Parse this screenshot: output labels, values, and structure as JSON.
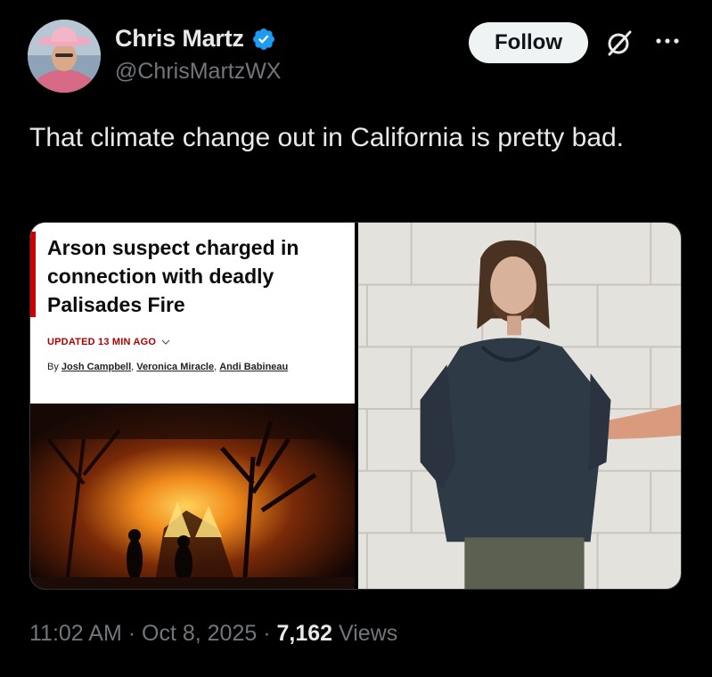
{
  "author": {
    "display_name": "Chris Martz",
    "handle": "@ChrisMartzWX",
    "verified": true
  },
  "actions": {
    "follow_label": "Follow",
    "grok_icon": "grok-icon",
    "more_icon": "more-icon"
  },
  "tweet": {
    "text": "That climate change out in California is pretty bad."
  },
  "media": {
    "article": {
      "headline": "Arson suspect charged in connection with deadly Palisades Fire",
      "updated": "UPDATED 13 MIN AGO",
      "by_prefix": "By",
      "authors": [
        "Josh Campbell",
        "Veronica Miracle",
        "Andi Babineau"
      ]
    }
  },
  "meta": {
    "time": "11:02 AM",
    "sep1": "·",
    "date": "Oct 8, 2025",
    "sep2": "·",
    "views_count": "7,162",
    "views_label": "Views"
  },
  "colors": {
    "background": "#000000",
    "text_primary": "#e7e9ea",
    "text_secondary": "#71767b",
    "verified_blue": "#1d9bf0",
    "cnn_red": "#cc0000"
  }
}
